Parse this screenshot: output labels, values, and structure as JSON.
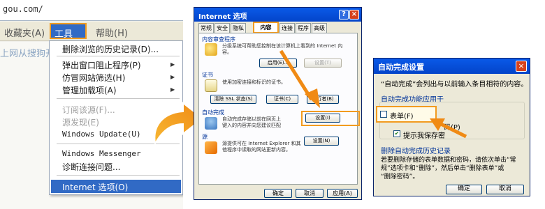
{
  "colors": {
    "accent": "#f29b1f",
    "selection": "#316ac5",
    "titlebar": "#0a5ae8",
    "group_text": "#003399"
  },
  "browser": {
    "address_fragment": "gou.com/",
    "menubar": {
      "favorites": "收藏夹(A)",
      "tools": "工具(T)",
      "help": "帮助(H)"
    },
    "bg_text": "上网从搜狗开",
    "tools_menu": {
      "items": [
        {
          "label": "删除浏览的历史记录(D)...",
          "enabled": true
        },
        {
          "label": "弹出窗口阻止程序(P)",
          "enabled": true,
          "submenu": true
        },
        {
          "label": "仿冒网站筛选(H)",
          "enabled": true,
          "submenu": true
        },
        {
          "label": "管理加载项(A)",
          "enabled": true,
          "submenu": true
        },
        {
          "label": "订阅该源(F)...",
          "enabled": false
        },
        {
          "label": "源发现(E)",
          "enabled": false,
          "submenu": true
        },
        {
          "label": "Windows Update(U)",
          "enabled": true
        },
        {
          "label": "Windows Messenger",
          "enabled": true
        },
        {
          "label": "诊断连接问题...",
          "enabled": true
        },
        {
          "label": "Internet 选项(O)",
          "enabled": true,
          "selected": true
        }
      ]
    }
  },
  "internet_options": {
    "title": "Internet 选项",
    "title_buttons": {
      "help": "?",
      "close": "×"
    },
    "tabs": [
      "常规",
      "安全",
      "隐私",
      "内容",
      "连接",
      "程序",
      "高级"
    ],
    "active_tab": "内容",
    "sections": {
      "content_advisor": {
        "title": "内容审查程序",
        "desc1": "分级系统可帮助您控制在该计算机上看到的 Internet 内",
        "desc2": "容。",
        "enable_button": "启用(E)...",
        "settings_button": "设置(T)"
      },
      "certificates": {
        "title": "证书",
        "desc": "使用加密连接和标识的证书。",
        "clear_ssl_button": "清除 SSL 状态(S)",
        "certs_button": "证书(C)",
        "publishers_button": "发行者(B)"
      },
      "autocomplete": {
        "title": "自动完成",
        "desc1": "自动完成存储以前在网页上",
        "desc2": "键入的内容并向您建议匹配",
        "settings_button": "设置(I)"
      },
      "feeds": {
        "title": "源",
        "desc1": "源提供可在 Internet Explorer 和其",
        "desc2": "他程序中读取的网站更新内容。",
        "settings_button": "设置(N)"
      }
    },
    "footer": {
      "ok": "确定",
      "cancel": "取消",
      "apply": "应用(A)"
    }
  },
  "autocomplete_settings": {
    "title": "自动完成设置",
    "close": "×",
    "intro": "“自动完成”会列出与以前输入条目相符的内容。",
    "use_for_label": "自动完成功能应用于",
    "options": [
      {
        "label": "表单(F)",
        "checked": false
      },
      {
        "label": "码(P)",
        "checked": false
      },
      {
        "label": "提示我保存密",
        "checked": true
      }
    ],
    "delete_history_label": "删除自动完成历史记录",
    "delete_desc1": "若要删除存储的表单数据和密码，请依次单击“常",
    "delete_desc2": "规”选项卡和“删除”，然后单击“删除表单”或",
    "delete_desc3": "“删除密码”。",
    "ok": "确定",
    "cancel": "取消"
  }
}
